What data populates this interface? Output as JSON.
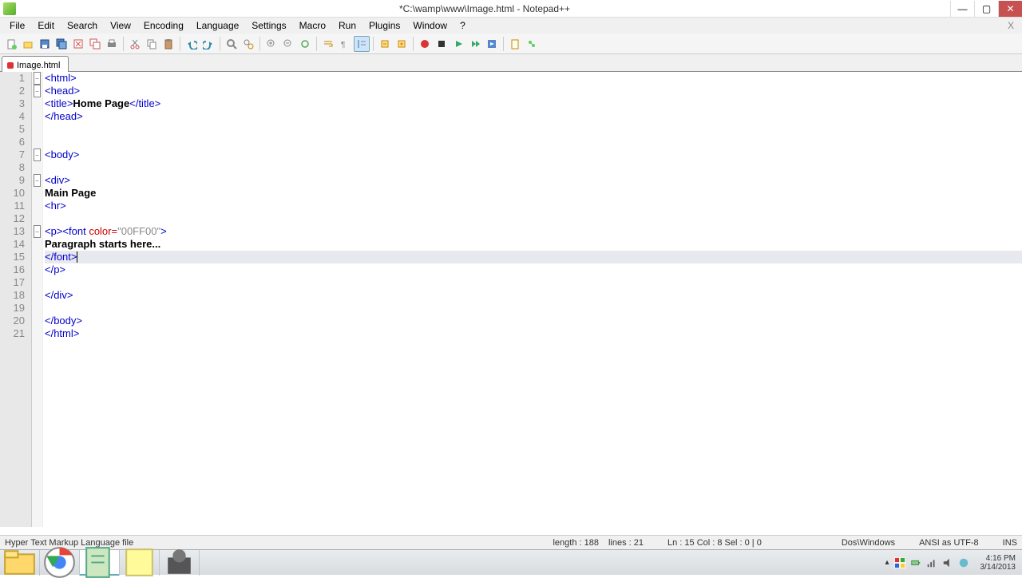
{
  "window": {
    "title": "*C:\\wamp\\www\\Image.html - Notepad++"
  },
  "menu": {
    "items": [
      "File",
      "Edit",
      "Search",
      "View",
      "Encoding",
      "Language",
      "Settings",
      "Macro",
      "Run",
      "Plugins",
      "Window",
      "?"
    ]
  },
  "tab": {
    "label": "Image.html"
  },
  "code": {
    "lines": [
      {
        "n": 1,
        "fold": "-",
        "tokens": [
          [
            "tag",
            "<html>"
          ]
        ]
      },
      {
        "n": 2,
        "fold": "-",
        "tokens": [
          [
            "tag",
            "<head>"
          ]
        ]
      },
      {
        "n": 3,
        "fold": "",
        "tokens": [
          [
            "tag",
            "<title>"
          ],
          [
            "txt",
            "Home Page"
          ],
          [
            "tag",
            "</title>"
          ]
        ]
      },
      {
        "n": 4,
        "fold": "",
        "tokens": [
          [
            "tag",
            "</head>"
          ]
        ]
      },
      {
        "n": 5,
        "fold": "",
        "tokens": []
      },
      {
        "n": 6,
        "fold": "",
        "tokens": []
      },
      {
        "n": 7,
        "fold": "-",
        "tokens": [
          [
            "tag",
            "<body>"
          ]
        ]
      },
      {
        "n": 8,
        "fold": "",
        "tokens": []
      },
      {
        "n": 9,
        "fold": "-",
        "tokens": [
          [
            "tag",
            "<div>"
          ]
        ]
      },
      {
        "n": 10,
        "fold": "",
        "tokens": [
          [
            "txt",
            "Main Page"
          ]
        ]
      },
      {
        "n": 11,
        "fold": "",
        "tokens": [
          [
            "tag",
            "<hr>"
          ]
        ]
      },
      {
        "n": 12,
        "fold": "",
        "tokens": []
      },
      {
        "n": 13,
        "fold": "-",
        "tokens": [
          [
            "tag",
            "<p><font "
          ],
          [
            "attr",
            "color="
          ],
          [
            "str",
            "\"00FF00\""
          ],
          [
            "tag",
            ">"
          ]
        ]
      },
      {
        "n": 14,
        "fold": "",
        "tokens": [
          [
            "txt",
            "Paragraph starts here..."
          ]
        ]
      },
      {
        "n": 15,
        "fold": "",
        "hl": true,
        "caret": true,
        "tokens": [
          [
            "tag",
            "</font>"
          ]
        ]
      },
      {
        "n": 16,
        "fold": "",
        "tokens": [
          [
            "tag",
            "</p>"
          ]
        ]
      },
      {
        "n": 17,
        "fold": "",
        "tokens": []
      },
      {
        "n": 18,
        "fold": "",
        "tokens": [
          [
            "tag",
            "</div>"
          ]
        ]
      },
      {
        "n": 19,
        "fold": "",
        "tokens": []
      },
      {
        "n": 20,
        "fold": "",
        "tokens": [
          [
            "tag",
            "</body>"
          ]
        ]
      },
      {
        "n": 21,
        "fold": "",
        "tokens": [
          [
            "tag",
            "</html>"
          ]
        ]
      }
    ]
  },
  "status": {
    "filetype": "Hyper Text Markup Language file",
    "length": "length : 188",
    "lines": "lines : 21",
    "pos": "Ln : 15   Col : 8   Sel : 0 | 0",
    "eol": "Dos\\Windows",
    "enc": "ANSI as UTF-8",
    "mode": "INS"
  },
  "clock": {
    "time": "4:16 PM",
    "date": "3/14/2013"
  },
  "toolbar_icons": [
    "new-file",
    "open-file",
    "save",
    "save-all",
    "close",
    "close-all",
    "print",
    "|",
    "cut",
    "copy",
    "paste",
    "|",
    "undo",
    "redo",
    "|",
    "find",
    "replace",
    "|",
    "zoom-in",
    "zoom-out",
    "sync",
    "|",
    "wordwrap",
    "show-all",
    "indent-guide",
    "|",
    "fold-all",
    "unfold-all",
    "|",
    "record-macro",
    "stop-macro",
    "play-macro",
    "play-multi",
    "save-macro",
    "|",
    "doc-map",
    "function-list"
  ]
}
